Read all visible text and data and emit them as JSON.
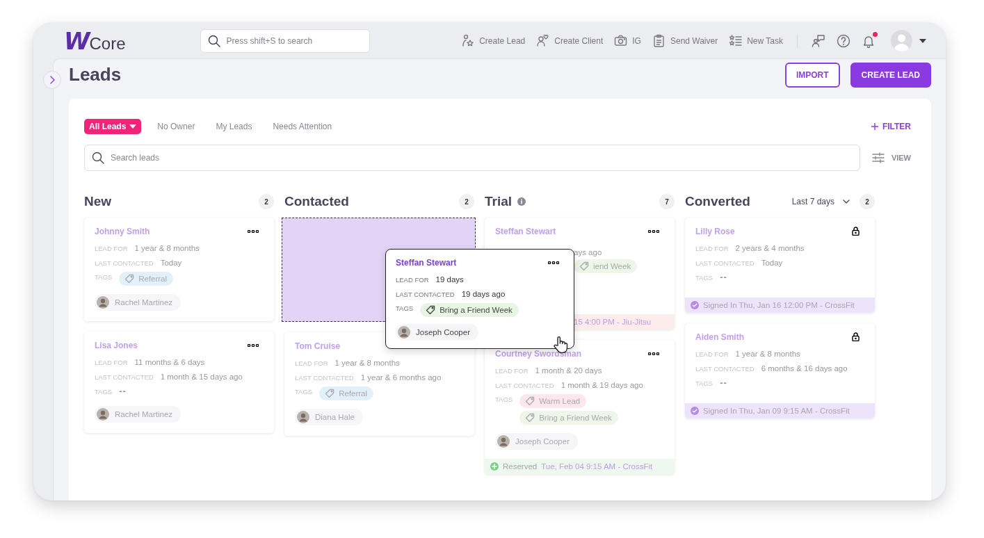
{
  "app": {
    "logo_mark": "W",
    "logo_text": "Core"
  },
  "search": {
    "placeholder": "Press shift+S to search"
  },
  "top_actions": [
    {
      "kind": "create-lead",
      "label": "Create Lead"
    },
    {
      "kind": "create-client",
      "label": "Create Client"
    },
    {
      "kind": "camera",
      "label": "IG"
    },
    {
      "kind": "waiver",
      "label": "Send Waiver"
    },
    {
      "kind": "task",
      "label": "New Task"
    }
  ],
  "notifications": {
    "unread": true
  },
  "page": {
    "title": "Leads"
  },
  "header_buttons": [
    {
      "kind": "outline",
      "label": "IMPORT"
    },
    {
      "kind": "primary",
      "label": "CREATE LEAD"
    }
  ],
  "filters": [
    {
      "label": "All Leads",
      "selected": true
    },
    {
      "label": "No Owner",
      "selected": false
    },
    {
      "label": "My Leads",
      "selected": false
    },
    {
      "label": "Needs Attention",
      "selected": false
    }
  ],
  "filter_button": {
    "label": "FILTER"
  },
  "lead_search": {
    "placeholder": "Search leads"
  },
  "view_button": {
    "label": "VIEW"
  },
  "columns": [
    {
      "title": "New",
      "count": "2",
      "info": false,
      "drop_placeholder": false,
      "cards": [
        {
          "kind": "lead",
          "name": "Johnny Smith",
          "menu": true,
          "locked": false,
          "fields": [
            {
              "kind": "text",
              "label": "LEAD FOR",
              "value": "1 year & 8 months"
            },
            {
              "kind": "text",
              "label": "LAST CONTACTED",
              "value": "Today"
            },
            {
              "kind": "tags",
              "label": "TAGS",
              "tags": [
                {
                  "label": "Referral",
                  "color": "#e2f0f8"
                }
              ]
            }
          ],
          "owner": "Rachel Martinez"
        },
        {
          "kind": "lead",
          "name": "Lisa Jones",
          "menu": true,
          "locked": false,
          "fields": [
            {
              "kind": "text",
              "label": "LEAD FOR",
              "value": "11 months & 6 days"
            },
            {
              "kind": "text",
              "label": "LAST CONTACTED",
              "value": "1 month & 15 days ago"
            },
            {
              "kind": "empty",
              "label": "TAGS",
              "text": "--"
            }
          ],
          "owner": "Rachel Martinez"
        }
      ]
    },
    {
      "title": "Contacted",
      "count": "2",
      "info": false,
      "drop_placeholder": true,
      "cards": [
        {
          "kind": "lead",
          "name": "Tom Cruise",
          "menu": false,
          "locked": false,
          "fields": [
            {
              "kind": "text",
              "label": "LEAD FOR",
              "value": "1 year & 8 months"
            },
            {
              "kind": "text",
              "label": "LAST CONTACTED",
              "value": "1 year & 6 months  ago"
            },
            {
              "kind": "tags",
              "label": "TAGS",
              "tags": [
                {
                  "label": "Referral",
                  "color": "#e2f0f8"
                }
              ]
            }
          ],
          "owner": "Diana Hale"
        }
      ]
    },
    {
      "title": "Trial",
      "count": "7",
      "info": true,
      "drop_placeholder": false,
      "cards": [
        {
          "kind": "partial",
          "name": "Steffan Stewart",
          "menu": true,
          "locked": false,
          "fragments": [
            {
              "kind": "text",
              "text": "ays ago"
            },
            {
              "kind": "tag",
              "text": "iend Week",
              "color": "#edf6e8"
            }
          ],
          "footer": {
            "kind": "class",
            "text": "15 4:00 PM - Jiu-Jitsu"
          }
        },
        {
          "kind": "lead",
          "name": "Courtney Swordsman",
          "menu": true,
          "locked": false,
          "fields": [
            {
              "kind": "text",
              "label": "LEAD FOR",
              "value": "1 month & 20 days"
            },
            {
              "kind": "text",
              "label": "LAST CONTACTED",
              "value": "1 month & 19 days ago"
            },
            {
              "kind": "tags",
              "label": "TAGS",
              "tags": [
                {
                  "label": "Warm Lead",
                  "color": "#fce8ec"
                },
                {
                  "label": "Bring a Friend Week",
                  "color": "#edf6e8"
                }
              ]
            }
          ],
          "owner": "Joseph Cooper",
          "footer": {
            "kind": "reserved",
            "label": "Reserved",
            "text": "Tue, Feb 04 9:15 AM - CrossFit"
          }
        }
      ]
    },
    {
      "title": "Converted",
      "count": "2",
      "info": false,
      "range": "Last 7 days",
      "drop_placeholder": false,
      "cards": [
        {
          "kind": "lead",
          "name": "Lilly Rose",
          "menu": false,
          "locked": true,
          "fields": [
            {
              "kind": "text",
              "label": "LEAD FOR",
              "value": "2 years & 4 months"
            },
            {
              "kind": "text",
              "label": "LAST CONTACTED",
              "value": "Today"
            },
            {
              "kind": "empty",
              "label": "TAGS",
              "text": "--"
            }
          ],
          "footer": {
            "kind": "signed",
            "text": "Signed In Thu, Jan 16 12:00 PM - CrossFit"
          }
        },
        {
          "kind": "lead",
          "name": "Aiden Smith",
          "menu": false,
          "locked": true,
          "fields": [
            {
              "kind": "text",
              "label": "LEAD FOR",
              "value": "1 year & 8 months"
            },
            {
              "kind": "text",
              "label": "LAST CONTACTED",
              "value": "6 months & 16 days ago"
            },
            {
              "kind": "empty",
              "label": "TAGS",
              "text": "--"
            }
          ],
          "footer": {
            "kind": "signed",
            "text": "Signed In Thu, Jan 09 9:15 AM - CrossFit"
          }
        }
      ]
    }
  ],
  "dragged_card": {
    "kind": "lead",
    "name": "Steffan Stewart",
    "menu": true,
    "locked": false,
    "fields": [
      {
        "kind": "text",
        "label": "LEAD FOR",
        "value": "19 days"
      },
      {
        "kind": "text",
        "label": "LAST CONTACTED",
        "value": "19 days ago"
      },
      {
        "kind": "tags",
        "label": "TAGS",
        "tags": [
          {
            "label": "Bring a Friend Week",
            "color": "#e9f5e3"
          }
        ]
      }
    ],
    "owner": "Joseph Cooper"
  }
}
